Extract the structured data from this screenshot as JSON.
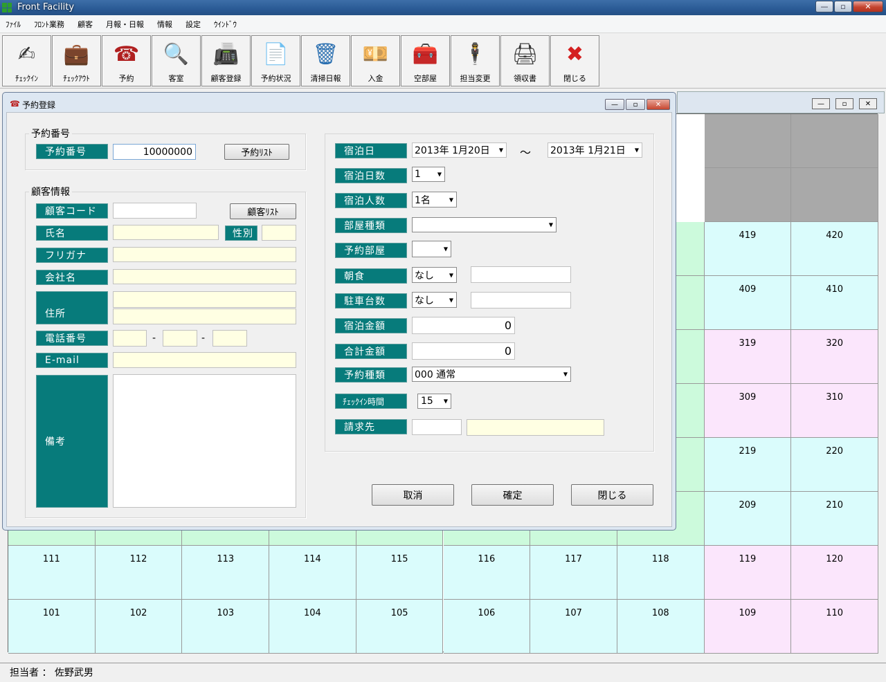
{
  "app": {
    "title": "Front Facility",
    "minimize": "—",
    "maximize": "▫",
    "close": "✕"
  },
  "menu": [
    "ﾌｧｲﾙ",
    "ﾌﾛﾝﾄ業務",
    "顧客",
    "月報・日報",
    "情報",
    "設定",
    "ｳｲﾝﾄﾞｳ"
  ],
  "toolbar": [
    {
      "label": "ﾁｪｯｸｲﾝ",
      "icon": "checkin-pen-icon",
      "glyph": "✍"
    },
    {
      "label": "ﾁｪｯｸｱｳﾄ",
      "icon": "briefcase-icon",
      "glyph": "💼"
    },
    {
      "label": "予約",
      "icon": "telephone-icon",
      "glyph": "☎"
    },
    {
      "label": "客室",
      "icon": "magnifier-document-icon",
      "glyph": "🔍"
    },
    {
      "label": "顧客登録",
      "icon": "printer-document-icon",
      "glyph": "📠"
    },
    {
      "label": "予約状況",
      "icon": "search-document-icon",
      "glyph": "📄"
    },
    {
      "label": "清掃日報",
      "icon": "recycle-bin-icon",
      "glyph": "🗑"
    },
    {
      "label": "入金",
      "icon": "money-icon",
      "glyph": "💴"
    },
    {
      "label": "空部屋",
      "icon": "treasure-box-icon",
      "glyph": "🧰"
    },
    {
      "label": "担当変更",
      "icon": "person-icon",
      "glyph": "🕴"
    },
    {
      "label": "領収書",
      "icon": "printer-icon",
      "glyph": "🖨"
    },
    {
      "label": "閉じる",
      "icon": "close-circle-icon",
      "glyph": "✖"
    }
  ],
  "dialog": {
    "title": "予約登録",
    "reservation_group": "予約番号",
    "reservation_no_label": "予約番号",
    "reservation_no_value": "10000000",
    "reservation_list_button": "予約ﾘｽﾄ",
    "customer_group": "顧客情報",
    "customer_code_label": "顧客コード",
    "customer_code_value": "",
    "customer_list_button": "顧客ﾘｽﾄ",
    "name_label": "氏名",
    "gender_label": "性別",
    "furigana_label": "フリガナ",
    "company_label": "会社名",
    "address_label": "住所",
    "phone_label": "電話番号",
    "phone_sep": "-",
    "email_label": "E-mail",
    "notes_label": "備考",
    "stay_date_label": "宿泊日",
    "stay_from": "2013年  1月20日",
    "stay_tilde": "～",
    "stay_to": "2013年  1月21日",
    "nights_label": "宿泊日数",
    "nights_value": "1",
    "guests_label": "宿泊人数",
    "guests_value": "1名",
    "room_type_label": "部屋種類",
    "room_type_value": "",
    "reserved_room_label": "予約部屋",
    "reserved_room_value": "",
    "breakfast_label": "朝食",
    "breakfast_value": "なし",
    "parking_label": "駐車台数",
    "parking_value": "なし",
    "stay_amount_label": "宿泊金額",
    "stay_amount_value": "0",
    "total_amount_label": "合計金額",
    "total_amount_value": "0",
    "reservation_type_label": "予約種類",
    "reservation_type_value": "000  通常",
    "checkin_time_label": "ﾁｪｯｸｲﾝ時間",
    "checkin_time_value": "15",
    "billing_label": "請求先",
    "cancel_button": "取消",
    "confirm_button": "確定",
    "close_button": "閉じる"
  },
  "room_grid": {
    "colors": {
      "green": "#ccfadc",
      "cyan": "#dafcfc",
      "pink": "#fbe6fc",
      "gray": "#a9a9a9"
    },
    "visible_rows": [
      {
        "cols": [
          "",
          "",
          "",
          "",
          "",
          "",
          "",
          "",
          "419",
          "420"
        ]
      },
      {
        "cols": [
          "",
          "",
          "",
          "",
          "",
          "",
          "",
          "",
          "409",
          "410"
        ]
      },
      {
        "cols": [
          "",
          "",
          "",
          "",
          "",
          "",
          "",
          "",
          "319",
          "320"
        ]
      },
      {
        "cols": [
          "",
          "",
          "",
          "",
          "",
          "",
          "",
          "",
          "309",
          "310"
        ]
      },
      {
        "cols": [
          "",
          "",
          "",
          "",
          "",
          "",
          "",
          "",
          "219",
          "220"
        ]
      },
      {
        "cols": [
          "",
          "",
          "",
          "",
          "",
          "",
          "",
          "",
          "209",
          "210"
        ]
      },
      {
        "cols": [
          "111",
          "112",
          "113",
          "114",
          "115",
          "116",
          "117",
          "118",
          "119",
          "120"
        ]
      },
      {
        "cols": [
          "101",
          "102",
          "103",
          "104",
          "105",
          "106",
          "107",
          "108",
          "109",
          "110"
        ]
      }
    ]
  },
  "status": {
    "text": "担当者 ： 佐野武男"
  }
}
